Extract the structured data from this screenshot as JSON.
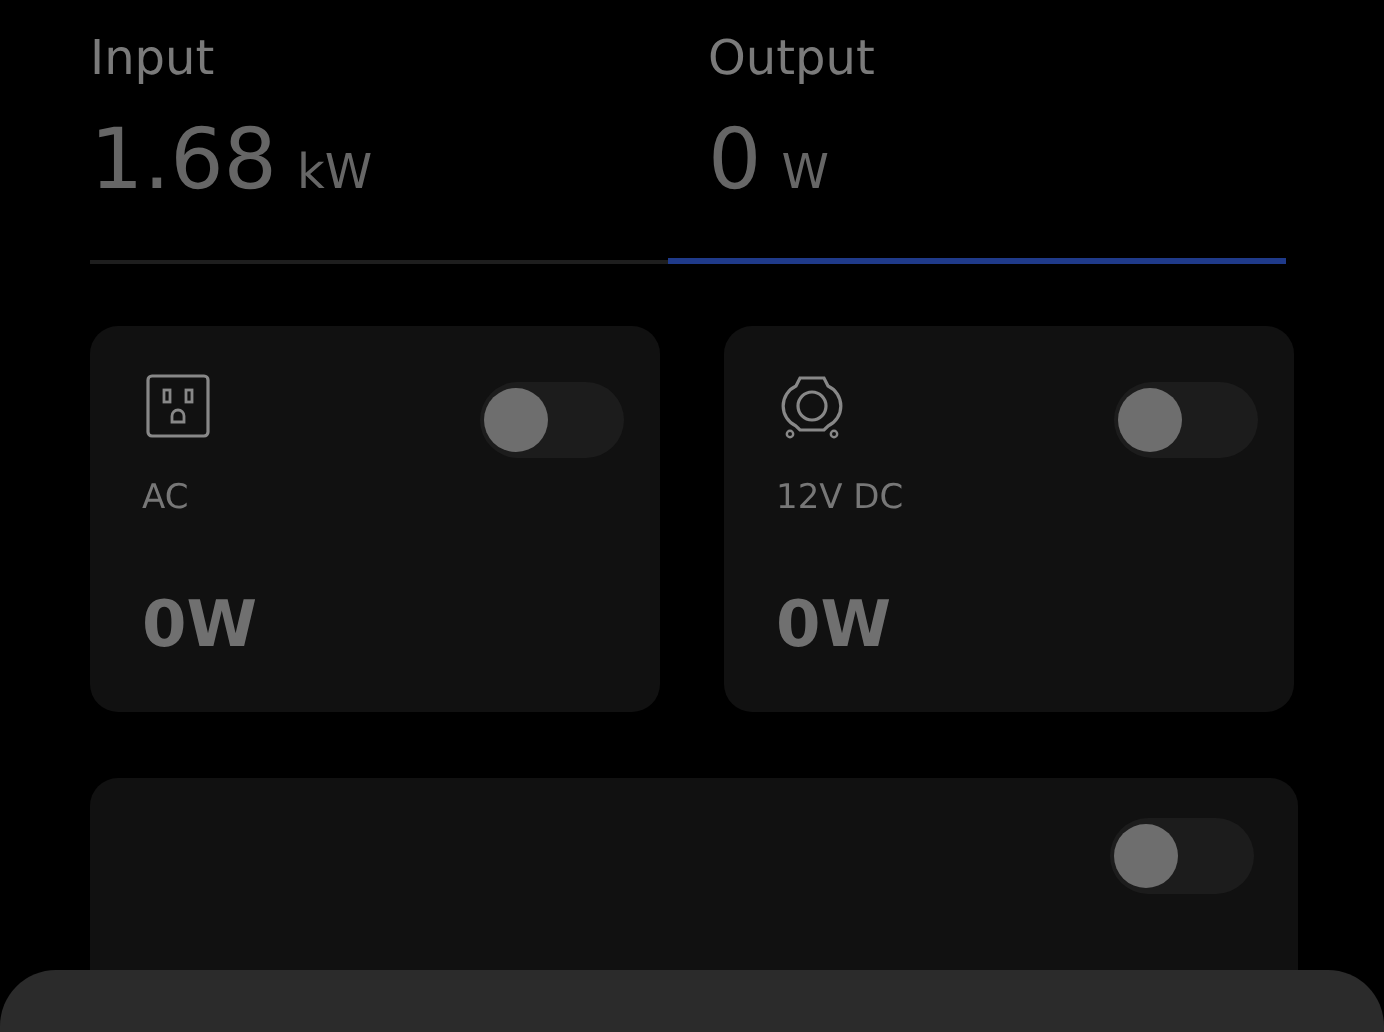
{
  "tabs": [
    {
      "label": "Input",
      "value": "1.68",
      "unit": "kW",
      "selected": false
    },
    {
      "label": "Output",
      "value": "0",
      "unit": "W",
      "selected": true
    }
  ],
  "outlets": [
    {
      "kind": "ac",
      "label": "AC",
      "power": "0W",
      "on": false
    },
    {
      "kind": "dc",
      "label": "12V DC",
      "power": "0W",
      "on": false
    }
  ],
  "extra_card": {
    "on": false
  }
}
